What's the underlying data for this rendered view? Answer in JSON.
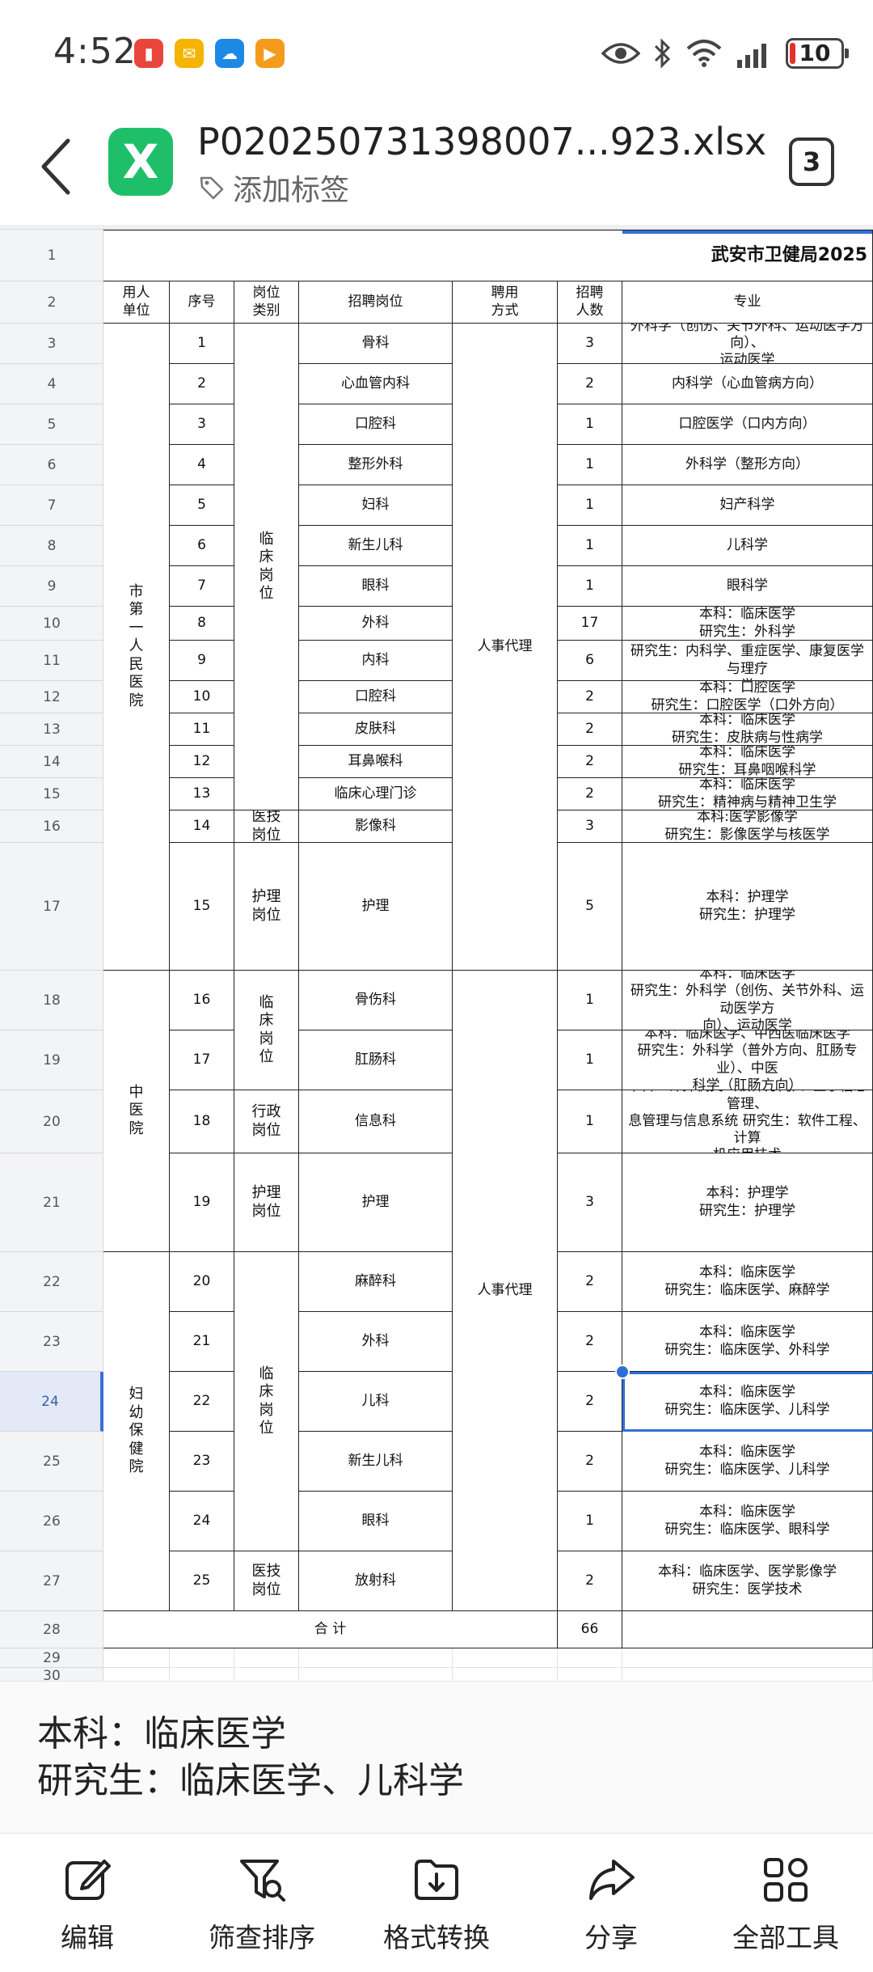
{
  "status_bar": {
    "time": "4:52",
    "battery": "10",
    "app_icons": [
      {
        "name": "app-icon-red",
        "glyph": "▮",
        "color": "#e9463b"
      },
      {
        "name": "mail-icon",
        "glyph": "✉",
        "color": "#f4b400"
      },
      {
        "name": "cloud-icon",
        "glyph": "☁",
        "color": "#1e88e5"
      },
      {
        "name": "play-icon",
        "glyph": "▶",
        "color": "#f59b1c"
      }
    ]
  },
  "header": {
    "file_name": "P020250731398007...923.xlsx",
    "tag_label": "添加标签",
    "count": "3",
    "app_letter": "X"
  },
  "sheet": {
    "row_numbers": [
      "1",
      "2",
      "3",
      "4",
      "5",
      "6",
      "7",
      "8",
      "9",
      "10",
      "11",
      "12",
      "13",
      "14",
      "15",
      "16",
      "17",
      "18",
      "19",
      "20",
      "21",
      "22",
      "23",
      "24",
      "25",
      "26",
      "27",
      "28",
      "29",
      "30"
    ],
    "title": "武安市卫健局2025",
    "headers": [
      "用人\n单位",
      "序号",
      "岗位\n类别",
      "招聘岗位",
      "聘用\n方式",
      "招聘\n人数",
      "专业"
    ],
    "units": [
      "市\n第\n一\n人\n民\n医\n院",
      "中\n医\n院",
      "妇\n幼\n保\n健\n院"
    ],
    "categories": [
      "临\n床\n岗\n位",
      "医技\n岗位",
      "护理\n岗位",
      "临\n床\n岗\n位",
      "行政\n岗位",
      "护理\n岗位",
      "临\n床\n岗\n位",
      "医技\n岗位"
    ],
    "hire_methods": [
      "人事代理",
      "人事代理"
    ],
    "rows": [
      {
        "no": "1",
        "post": "骨科",
        "count": "3",
        "major": "外科学（创伤、关节外科、运动医学方向）、\n运动医学"
      },
      {
        "no": "2",
        "post": "心血管内科",
        "count": "2",
        "major": "内科学（心血管病方向）"
      },
      {
        "no": "3",
        "post": "口腔科",
        "count": "1",
        "major": "口腔医学（口内方向）"
      },
      {
        "no": "4",
        "post": "整形外科",
        "count": "1",
        "major": "外科学（整形方向）"
      },
      {
        "no": "5",
        "post": "妇科",
        "count": "1",
        "major": "妇产科学"
      },
      {
        "no": "6",
        "post": "新生儿科",
        "count": "1",
        "major": "儿科学"
      },
      {
        "no": "7",
        "post": "眼科",
        "count": "1",
        "major": "眼科学"
      },
      {
        "no": "8",
        "post": "外科",
        "count": "17",
        "major": "本科：临床医学\n研究生：外科学"
      },
      {
        "no": "9",
        "post": "内科",
        "count": "6",
        "major": "本科：临床医学\n研究生：内科学、重症医学、康复医学与理疗\n学"
      },
      {
        "no": "10",
        "post": "口腔科",
        "count": "2",
        "major": "本科：口腔医学\n研究生：口腔医学（口外方向）"
      },
      {
        "no": "11",
        "post": "皮肤科",
        "count": "2",
        "major": "本科：临床医学\n研究生：皮肤病与性病学"
      },
      {
        "no": "12",
        "post": "耳鼻喉科",
        "count": "2",
        "major": "本科：临床医学\n研究生：耳鼻咽喉科学"
      },
      {
        "no": "13",
        "post": "临床心理门诊",
        "count": "2",
        "major": "本科：临床医学\n研究生：精神病与精神卫生学"
      },
      {
        "no": "14",
        "post": "影像科",
        "count": "3",
        "major": "本科:医学影像学\n研究生：影像医学与核医学"
      },
      {
        "no": "15",
        "post": "护理",
        "count": "5",
        "major": "本科：护理学\n研究生：护理学"
      },
      {
        "no": "16",
        "post": "骨伤科",
        "count": "1",
        "major": "本科：临床医学\n研究生：外科学（创伤、关节外科、运动医学方\n向）、运动医学"
      },
      {
        "no": "17",
        "post": "肛肠科",
        "count": "1",
        "major": "本科：临床医学、中西医临床医学\n研究生：外科学（普外方向、肛肠专业）、中医\n科学（肛肠方向）"
      },
      {
        "no": "18",
        "post": "信息科",
        "count": "1",
        "major": "本科：计算机类（软件方向）、医学信息管理、\n息管理与信息系统    研究生：软件工程、计算\n机应用技术"
      },
      {
        "no": "19",
        "post": "护理",
        "count": "3",
        "major": "本科：护理学\n研究生：护理学"
      },
      {
        "no": "20",
        "post": "麻醉科",
        "count": "2",
        "major": "本科：临床医学\n研究生：临床医学、麻醉学"
      },
      {
        "no": "21",
        "post": "外科",
        "count": "2",
        "major": "本科：临床医学\n研究生：临床医学、外科学"
      },
      {
        "no": "22",
        "post": "儿科",
        "count": "2",
        "major": "本科：临床医学\n研究生：临床医学、儿科学"
      },
      {
        "no": "23",
        "post": "新生儿科",
        "count": "2",
        "major": "本科：临床医学\n研究生：临床医学、儿科学"
      },
      {
        "no": "24",
        "post": "眼科",
        "count": "1",
        "major": "本科：临床医学\n研究生：临床医学、眼科学"
      },
      {
        "no": "25",
        "post": "放射科",
        "count": "2",
        "major": "本科：临床医学、医学影像学\n研究生：医学技术"
      }
    ],
    "total_label": "合   计",
    "total_count": "66"
  },
  "preview_text": "本科：临床医学\n研究生：临床医学、儿科学",
  "toolbar": [
    {
      "name": "edit",
      "label": "编辑"
    },
    {
      "name": "filter-sort",
      "label": "筛查排序"
    },
    {
      "name": "format-convert",
      "label": "格式转换"
    },
    {
      "name": "share",
      "label": "分享"
    },
    {
      "name": "all-tools",
      "label": "全部工具"
    }
  ],
  "colors": {
    "accent": "#2f6fd8",
    "excel_green": "#1fbf6a"
  }
}
